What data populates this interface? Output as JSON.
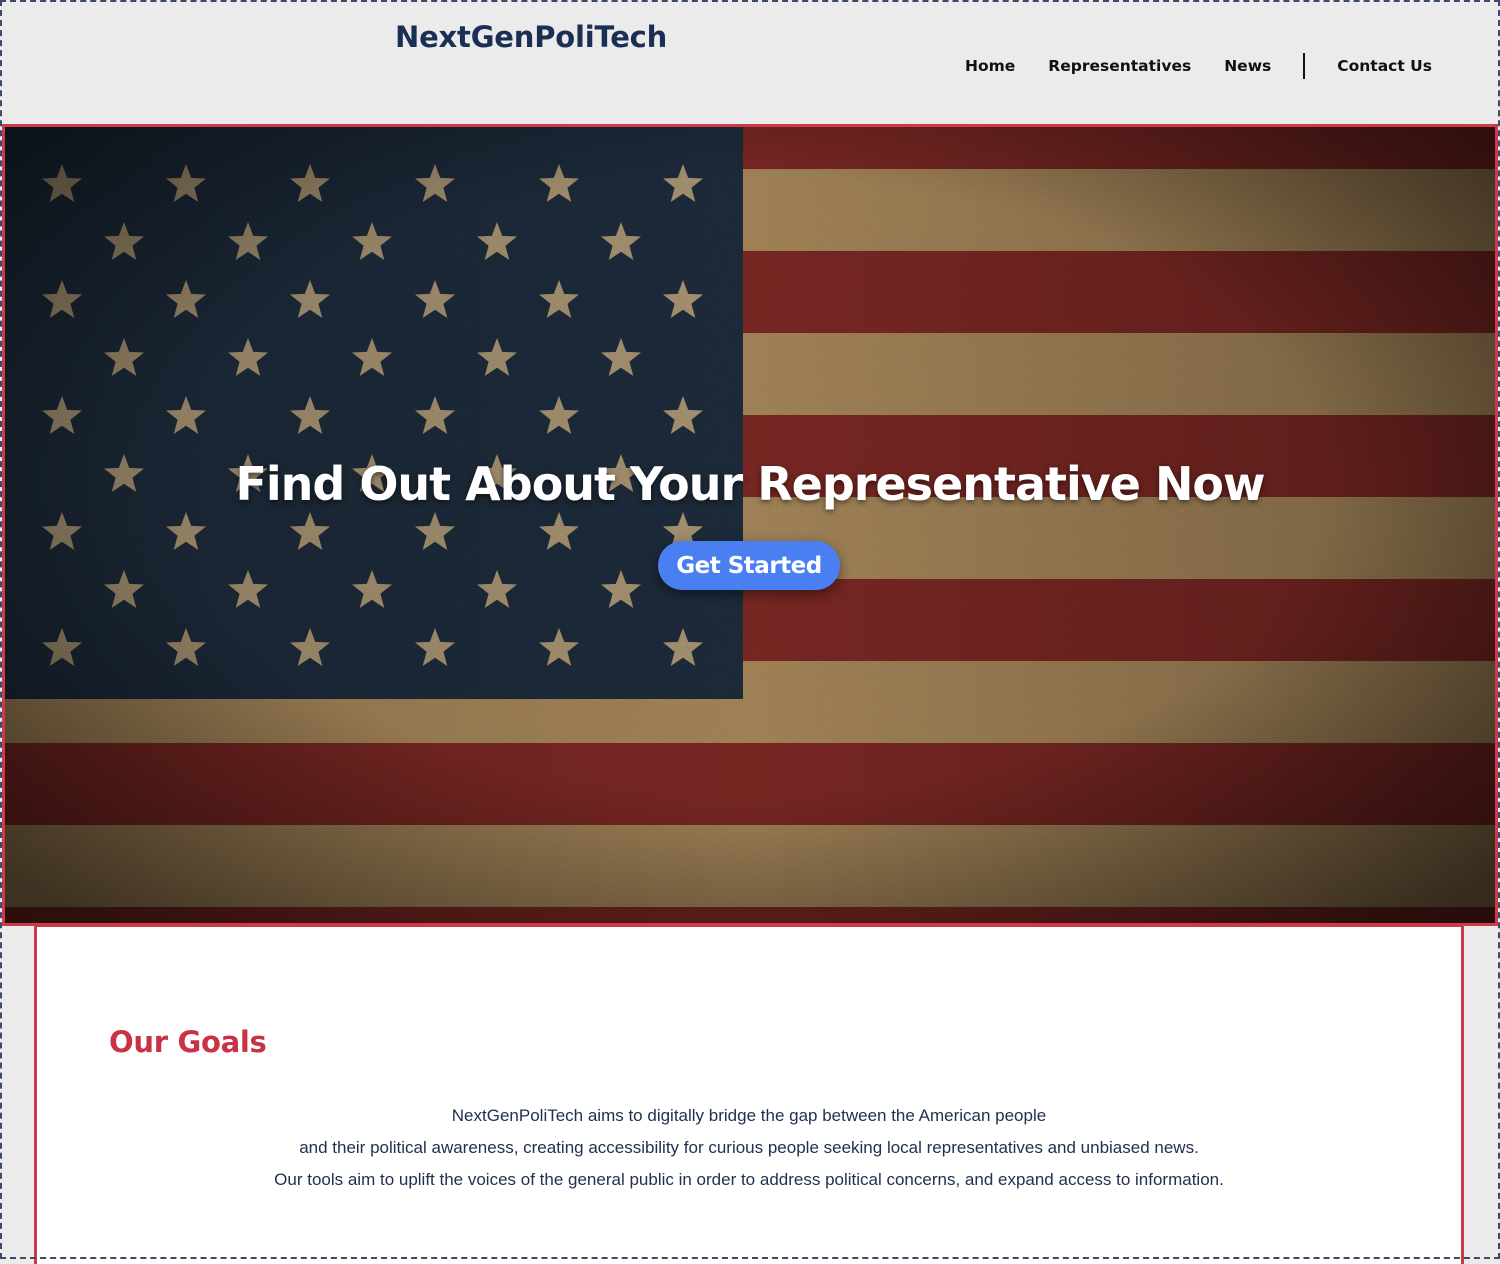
{
  "brand": {
    "name": "NextGenPoliTech"
  },
  "nav": {
    "home": "Home",
    "representatives": "Representatives",
    "news": "News",
    "contact": "Contact Us"
  },
  "hero": {
    "title": "Find Out About Your Representative Now",
    "button_label": "Get Started"
  },
  "goals": {
    "title": "Our Goals",
    "lines": [
      "NextGenPoliTech aims to digitally bridge the gap between the American people",
      "and their political awareness, creating accessibility for curious people seeking local representatives and unbiased news.",
      "Our tools aim to uplift the voices of the general public in order to address political concerns, and expand access to information."
    ]
  },
  "colors": {
    "brand": "#1b2f55",
    "accent_red": "#cf3a4b",
    "button_blue": "#4a7ff1",
    "flag_blue": "#1f2d3d",
    "flag_red": "#7f2a24",
    "flag_tan": "#a9895c"
  }
}
